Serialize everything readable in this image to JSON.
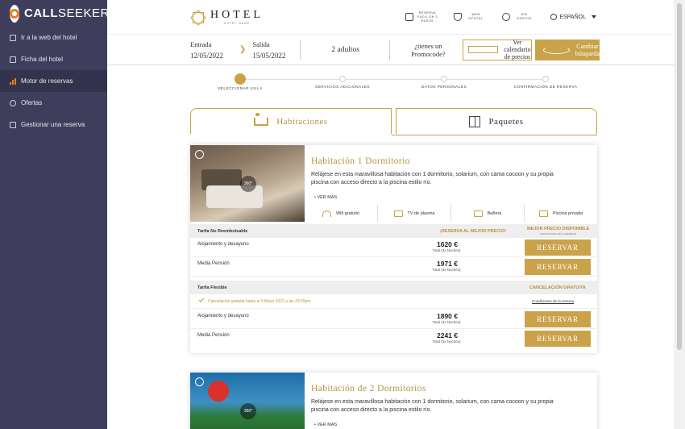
{
  "sidebar": {
    "logo_call": "CALL",
    "logo_seeker": "SEEKER",
    "items": [
      {
        "label": "Ir a la web del hotel"
      },
      {
        "label": "Ficha del hotel"
      },
      {
        "label": "Motor de reservas"
      },
      {
        "label": "Ofertas"
      },
      {
        "label": "Gestionar una reserva"
      }
    ]
  },
  "header": {
    "brand": "HOTEL",
    "brand_sub": "HOTEL NAME",
    "nav": [
      {
        "label": "RESERVA FÁCIL EN 3 PASOS"
      },
      {
        "label": "WEB OFICIAL"
      },
      {
        "label": "SIN GASTOS"
      }
    ],
    "language": "ESPAÑOL"
  },
  "search": {
    "checkin_label": "Entrada",
    "checkin_value": "12/05/2022",
    "checkout_label": "Salida",
    "checkout_value": "15/05/2022",
    "guests": "2 adultos",
    "promo": "¿tienes un Promocode?",
    "calendar_button": "Ver calendario de precios",
    "change_button": "Cambiar búsqueda"
  },
  "steps": [
    {
      "label": "SELECCIONAR VILLA"
    },
    {
      "label": "SERVICIOS ADICIONALES"
    },
    {
      "label": "DATOS PERSONALES"
    },
    {
      "label": "CONFIRMACIÓN DE RESERVA"
    }
  ],
  "tabs": {
    "rooms": "Habitaciones",
    "packages": "Paquetes"
  },
  "rooms": [
    {
      "title": "Habitación 1 Dormitorio",
      "description": "Relájese en esta maravillosa habitación con 1 dormitorio, solarium, con cama cocoon y su propia piscina con acceso directo a la piscina estilo río.",
      "more": "VER MÁS",
      "amenities": [
        "Wifi gratuito",
        "TV de plasma",
        "Bañera",
        "Piscina privada"
      ],
      "rate1": {
        "name": "Tarifa No Reembolsable",
        "best_price": "¡RESERVA AL MEJOR PRECIO!",
        "best_available": "MEJOR PRECIO DISPONIBLE",
        "best_available_sub": "CONDICIONES DE LA RESERVA",
        "rows": [
          {
            "board": "Alojamiento y desayuno",
            "price": "1620 €",
            "sub": "Total (3x Noches)",
            "button": "RESERVAR"
          },
          {
            "board": "Media Pensión",
            "price": "1971 €",
            "sub": "Total (3x Noches)",
            "button": "RESERVAR"
          }
        ]
      },
      "rate2": {
        "name": "Tarifa Flexible",
        "cancel_label": "CANCELACIÓN GRATUITA",
        "free_cancel": "Cancelación gratuita hasta el 9 Mayo 2022 a las 23:59pm",
        "conditions": "Condiciones de la reserva",
        "rows": [
          {
            "board": "Alojamiento y desayuno",
            "price": "1890 €",
            "sub": "Total (3x Noches)",
            "button": "RESERVAR"
          },
          {
            "board": "Media Pensión",
            "price": "2241 €",
            "sub": "Total (3x Noches)",
            "button": "RESERVAR"
          }
        ]
      }
    },
    {
      "title": "Habitación de 2 Dormitorios",
      "description": "Relájese en esta maravillosa habitación con 1 dormitorio, solarium, con cama cocoon y su propia piscina con acceso directo a la piscina estilo río.",
      "more": "VER MÁS"
    }
  ],
  "colors": {
    "accent": "#c9a24a",
    "sidebar": "#3e3e5c",
    "logo_orange": "#e67e22"
  }
}
